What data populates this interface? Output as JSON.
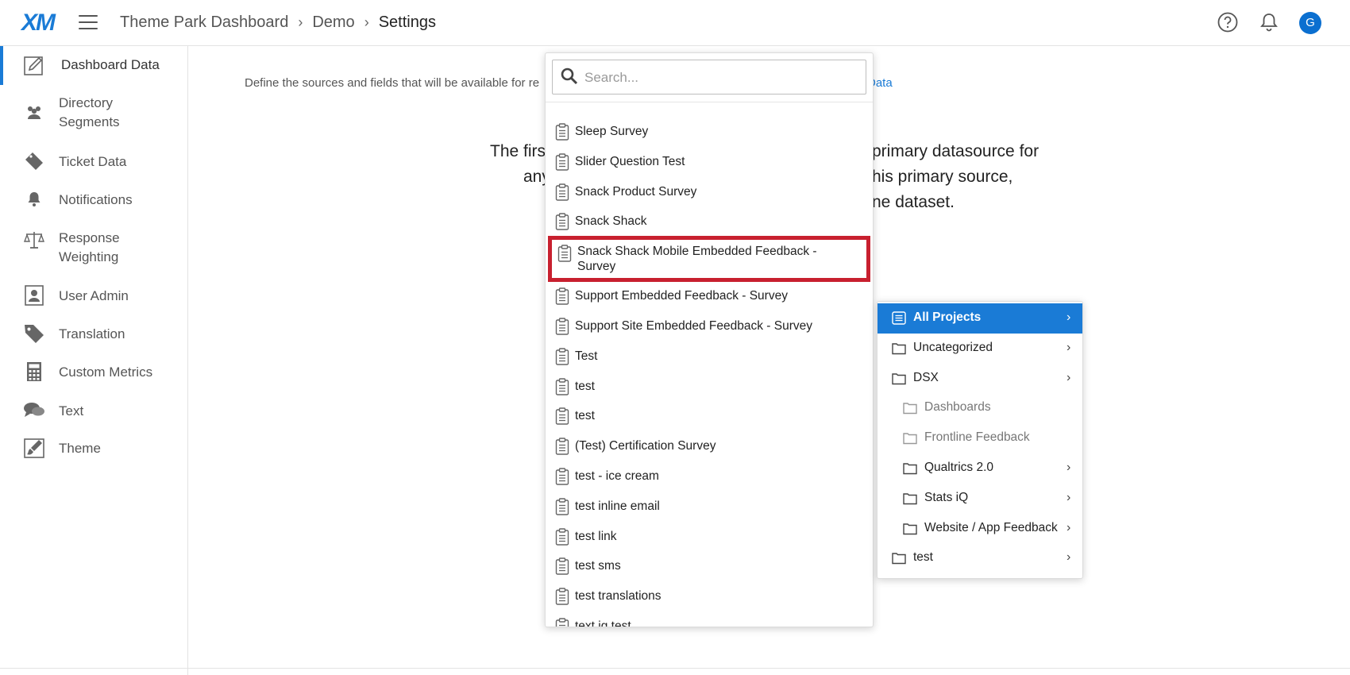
{
  "header": {
    "logo": "XM",
    "breadcrumb": [
      "Theme Park Dashboard",
      "Demo",
      "Settings"
    ],
    "avatar_initial": "G"
  },
  "sidebar": {
    "items": [
      {
        "label": "Dashboard Data",
        "icon": "pencil-icon",
        "active": true
      },
      {
        "label": "Directory\nSegments",
        "icon": "users-icon"
      },
      {
        "label": "Ticket Data",
        "icon": "ticket-icon"
      },
      {
        "label": "Notifications",
        "icon": "bell-icon"
      },
      {
        "label": "Response\nWeighting",
        "icon": "scale-icon"
      },
      {
        "label": "User Admin",
        "icon": "user-badge-icon"
      },
      {
        "label": "Translation",
        "icon": "tag-icon"
      },
      {
        "label": "Custom Metrics",
        "icon": "calculator-icon"
      },
      {
        "label": "Text",
        "icon": "chat-bubbles-icon"
      },
      {
        "label": "Theme",
        "icon": "brush-icon"
      }
    ]
  },
  "main": {
    "intro": "Define the sources and fields that will be available for re",
    "intro_link": "Data",
    "text_lines": [
      {
        "left": "The firs",
        "right": "primary datasource for"
      },
      {
        "left": "any",
        "right": "his primary source,"
      },
      {
        "left": "",
        "right": "ne dataset."
      }
    ]
  },
  "dropdown": {
    "search_placeholder": "Search...",
    "items": [
      "Sleep Survey",
      "Slider Question Test",
      "Snack Product Survey",
      "Snack Shack",
      "Snack Shack Mobile Embedded Feedback - Survey",
      "Support Embedded Feedback - Survey",
      "Support Site Embedded Feedback - Survey",
      "Test",
      "test",
      "test",
      "(Test) Certification Survey",
      "test - ice cream",
      "test inline email",
      "test link",
      "test sms",
      "test translations",
      "text iq test"
    ],
    "highlighted_index": 4,
    "highlight_color": "#c8202f"
  },
  "submenu": {
    "items": [
      {
        "label": "All Projects",
        "level": 0,
        "selected": true,
        "chevron": true,
        "icon": "list-icon"
      },
      {
        "label": "Uncategorized",
        "level": 0,
        "chevron": true,
        "icon": "folder-icon"
      },
      {
        "label": "DSX",
        "level": 0,
        "chevron": true,
        "icon": "folder-icon"
      },
      {
        "label": "Dashboards",
        "level": 1,
        "disabled": true,
        "icon": "folder-icon"
      },
      {
        "label": "Frontline Feedback",
        "level": 1,
        "disabled": true,
        "icon": "folder-icon"
      },
      {
        "label": "Qualtrics 2.0",
        "level": 1,
        "chevron": true,
        "icon": "folder-icon"
      },
      {
        "label": "Stats iQ",
        "level": 1,
        "chevron": true,
        "icon": "folder-icon"
      },
      {
        "label": "Website / App Feedback",
        "level": 1,
        "chevron": true,
        "icon": "folder-icon"
      },
      {
        "label": "test",
        "level": 0,
        "chevron": true,
        "icon": "folder-icon"
      }
    ],
    "accent": "#1a7bd6"
  }
}
